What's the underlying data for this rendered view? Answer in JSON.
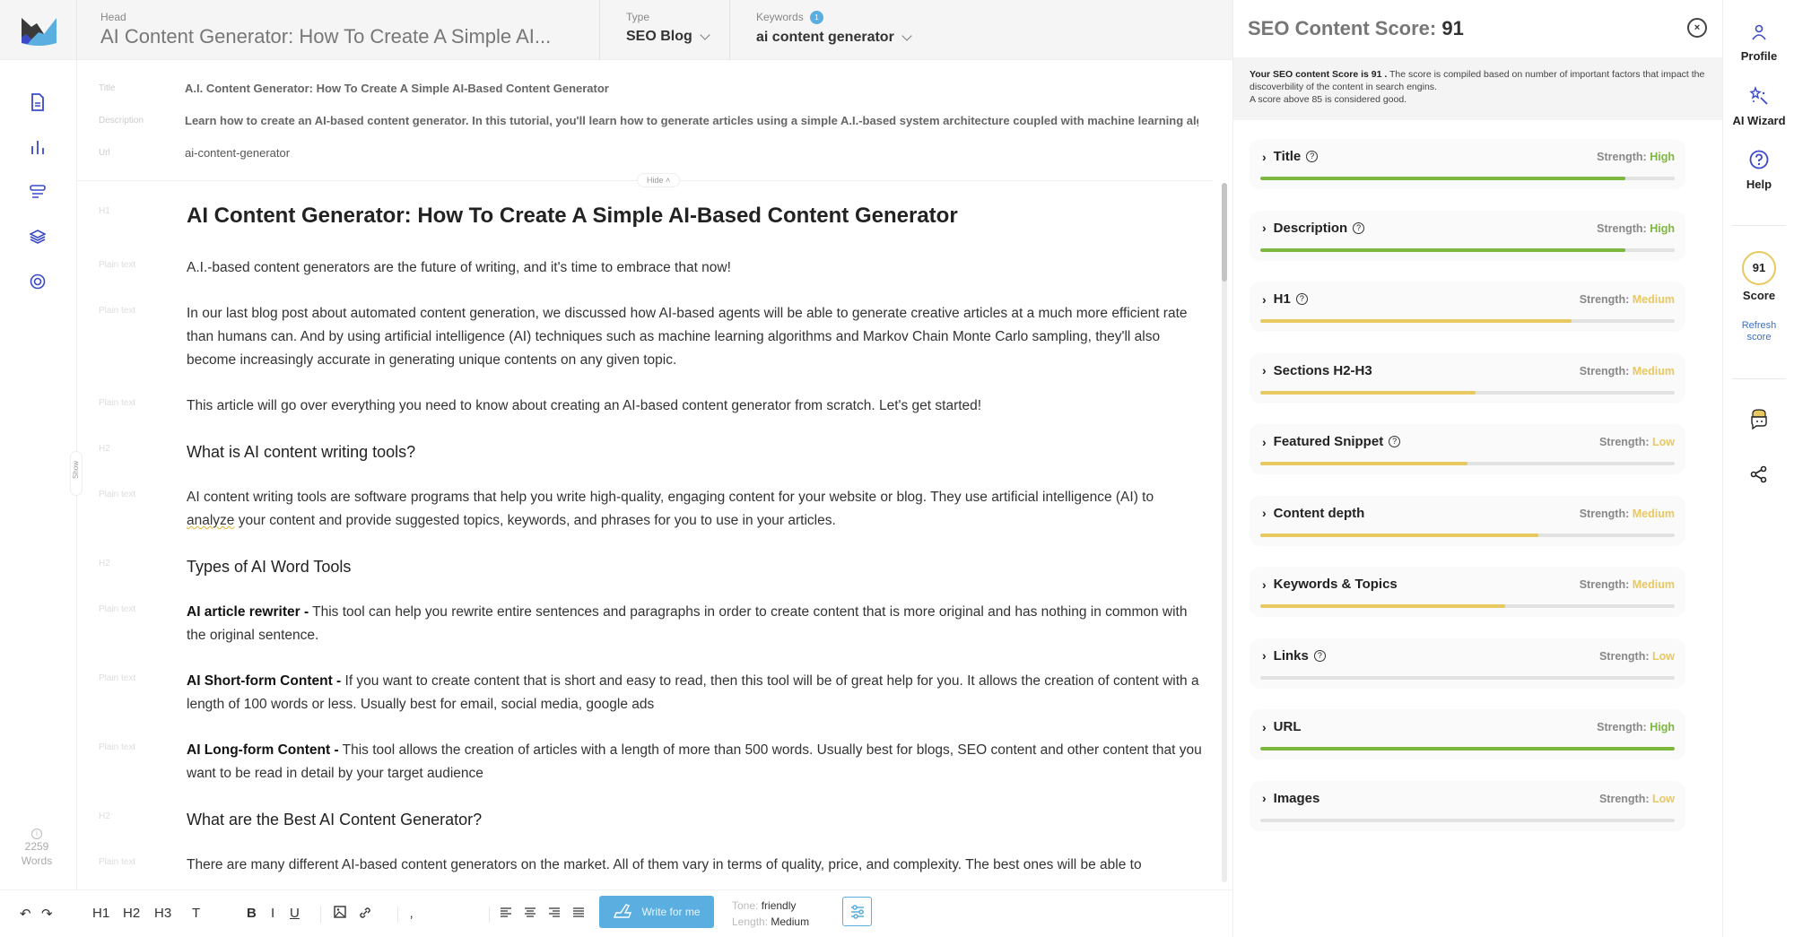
{
  "header": {
    "head_label": "Head",
    "head_title": "AI Content Generator: How To Create A Simple AI...",
    "type_label": "Type",
    "type_value": "SEO Blog",
    "keywords_label": "Keywords",
    "keywords_count": "1",
    "keywords_value": "ai content generator"
  },
  "sidebar": {
    "items": [
      {
        "icon": "document-icon"
      },
      {
        "icon": "bar-chart-icon"
      },
      {
        "icon": "outline-icon"
      },
      {
        "icon": "layers-icon"
      },
      {
        "icon": "target-icon"
      }
    ],
    "word_count": "2259",
    "word_label": "Words"
  },
  "meta": {
    "title_label": "Title",
    "title_value": "A.I. Content Generator: How To Create A Simple AI-Based Content Generator",
    "description_label": "Description",
    "description_value": "Learn how to create an AI-based content generator. In this tutorial, you'll learn how to generate articles using a simple A.I.-based system architecture coupled with machine learning algorithms",
    "url_label": "Url",
    "url_value": "ai-content-generator",
    "hide_label": "Hide",
    "show_label": "Show"
  },
  "editor": {
    "blocks": [
      {
        "type": "H1",
        "text": "AI Content Generator: How To Create A Simple AI-Based Content Generator"
      },
      {
        "type": "Plain text",
        "text": "A.I.-based content generators are the future of writing, and it's time to embrace that now!"
      },
      {
        "type": "Plain text",
        "text": "In our last blog post about automated content generation, we discussed how AI-based agents will be able to generate creative articles at a much more efficient rate than humans can. And by using artificial intelligence (AI) techniques such as machine learning algorithms and Markov Chain Monte Carlo sampling, they'll also become increasingly accurate in generating unique contents on any given topic."
      },
      {
        "type": "Plain text",
        "text": "This article will go over everything you need to know about creating an AI-based content generator from scratch. Let's get started!"
      },
      {
        "type": "H2",
        "text": "What is AI content writing tools?"
      },
      {
        "type": "Plain text",
        "text_before": "AI content writing tools are software programs that help you write high-quality, engaging content for your website or blog. They use artificial intelligence (AI) to ",
        "flagged_word": "analyze",
        "text_after": " your content and provide suggested topics, keywords, and phrases for you to use in your articles."
      },
      {
        "type": "H2",
        "text": "Types of AI Word Tools"
      },
      {
        "type": "Plain text",
        "bold": "AI article rewriter -",
        "text": " This tool can help you rewrite entire sentences and paragraphs in order to create content that is more original and has nothing in common with the original sentence."
      },
      {
        "type": "Plain text",
        "bold": "AI Short-form Content -",
        "text": "  If you want to create content that is short and easy to read, then this tool will be of great help for you. It allows the creation of content with a length of 100 words or less. Usually best for email, social media, google ads"
      },
      {
        "type": "Plain text",
        "bold": "AI Long-form Content -",
        "text": "  This tool allows the creation of articles with a length of more than 500 words. Usually best for blogs, SEO content and other content that you want to be read in detail by your target audience"
      },
      {
        "type": "H2",
        "text": "What are the Best AI Content Generator?"
      },
      {
        "type": "Plain text",
        "text": "There are many different AI-based content generators on the market. All of them vary in terms of quality, price, and complexity. The best ones will be able to"
      }
    ]
  },
  "toolbar": {
    "undo": "undo-icon",
    "redo": "redo-icon",
    "h1": "H1",
    "h2": "H2",
    "h3": "H3",
    "t": "T",
    "bold": "B",
    "italic": "I",
    "underline": "U",
    "quote": "‚",
    "write_label": "Write for me",
    "tone_label": "Tone:",
    "tone_value": "friendly",
    "length_label": "Length:",
    "length_value": "Medium"
  },
  "seo_panel": {
    "title_prefix": "SEO Content Score:",
    "score": "91",
    "info_bold": "Your SEO content Score is 91 .",
    "info_text": " The score is compiled based on number of important factors that impact the discoverbility of the content in search engins.",
    "info_line2": "A score above 85 is considered good.",
    "strength_label": "Strength:",
    "colors": {
      "High": "#7cb83e",
      "Medium": "#e8c860",
      "Low": "#e8c860"
    },
    "sections": [
      {
        "name": "Title",
        "help": true,
        "strength": "High",
        "progress": 0.88
      },
      {
        "name": "Description",
        "help": true,
        "strength": "High",
        "progress": 0.88
      },
      {
        "name": "H1",
        "help": true,
        "strength": "Medium",
        "progress": 0.75
      },
      {
        "name": "Sections H2-H3",
        "help": false,
        "strength": "Medium",
        "progress": 0.52
      },
      {
        "name": "Featured Snippet",
        "help": true,
        "strength": "Low",
        "progress": 0.5
      },
      {
        "name": "Content depth",
        "help": false,
        "strength": "Medium",
        "progress": 0.67
      },
      {
        "name": "Keywords & Topics",
        "help": false,
        "strength": "Medium",
        "progress": 0.59
      },
      {
        "name": "Links",
        "help": true,
        "strength": "Low",
        "progress": 0.0
      },
      {
        "name": "URL",
        "help": false,
        "strength": "High",
        "progress": 1.0
      },
      {
        "name": "Images",
        "help": false,
        "strength": "Low",
        "progress": 0.0
      }
    ]
  },
  "rail": {
    "profile": "Profile",
    "wizard": "AI Wizard",
    "help": "Help",
    "score_value": "91",
    "score_label": "Score",
    "refresh_label": "Refresh score"
  }
}
